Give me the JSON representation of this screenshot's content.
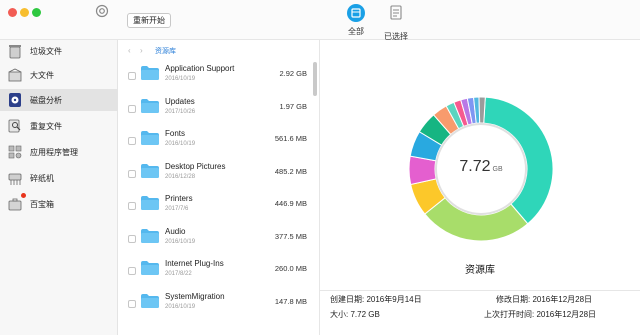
{
  "toolbar": {
    "restart_label": "重新开始",
    "seg_all_label": "全部",
    "seg_selected_label": "已选择"
  },
  "sidebar": {
    "items": [
      {
        "label": "垃圾文件",
        "icon": "trash-icon"
      },
      {
        "label": "大文件",
        "icon": "box-icon"
      },
      {
        "label": "磁盘分析",
        "icon": "disk-analysis-icon",
        "active": true
      },
      {
        "label": "重复文件",
        "icon": "duplicate-icon"
      },
      {
        "label": "应用程序管理",
        "icon": "apps-icon"
      },
      {
        "label": "碎纸机",
        "icon": "shredder-icon"
      },
      {
        "label": "百宝箱",
        "icon": "toolbox-icon"
      }
    ]
  },
  "breadcrumb": {
    "label": "资源库"
  },
  "files": [
    {
      "name": "Application Support",
      "date": "2016/10/19",
      "size": "2.92 GB"
    },
    {
      "name": "Updates",
      "date": "2017/10/26",
      "size": "1.97 GB"
    },
    {
      "name": "Fonts",
      "date": "2016/10/19",
      "size": "561.6 MB"
    },
    {
      "name": "Desktop Pictures",
      "date": "2016/12/28",
      "size": "485.2 MB"
    },
    {
      "name": "Printers",
      "date": "2017/7/6",
      "size": "446.9 MB"
    },
    {
      "name": "Audio",
      "date": "2016/10/19",
      "size": "377.5 MB"
    },
    {
      "name": "Internet Plug-Ins",
      "date": "2017/8/22",
      "size": "260.0 MB"
    },
    {
      "name": "SystemMigration",
      "date": "2016/10/19",
      "size": "147.8 MB"
    }
  ],
  "detail": {
    "total_value": "7.72",
    "total_unit": "GB",
    "title": "资源库",
    "created": "创建日期:  2016年9月14日",
    "modified": "修改日期:  2016年12月28日",
    "size": "大小:  7.72 GB",
    "last_opened": "上次打开时间:  2016年12月28日"
  },
  "donut": {
    "colors": [
      "#2fd6b9",
      "#a8dd6a",
      "#fcc82a",
      "#e45fcf",
      "#29a9e0",
      "#16b582",
      "#f89b6d",
      "#5ad5c0",
      "#f65a8f",
      "#b978e6",
      "#7f96f2",
      "#53b8e0",
      "#9b9b9b"
    ],
    "values": [
      37.8,
      25.5,
      7.3,
      6.3,
      5.8,
      4.9,
      3.4,
      1.9,
      1.6,
      1.5,
      1.4,
      1.2,
      1.4
    ]
  }
}
